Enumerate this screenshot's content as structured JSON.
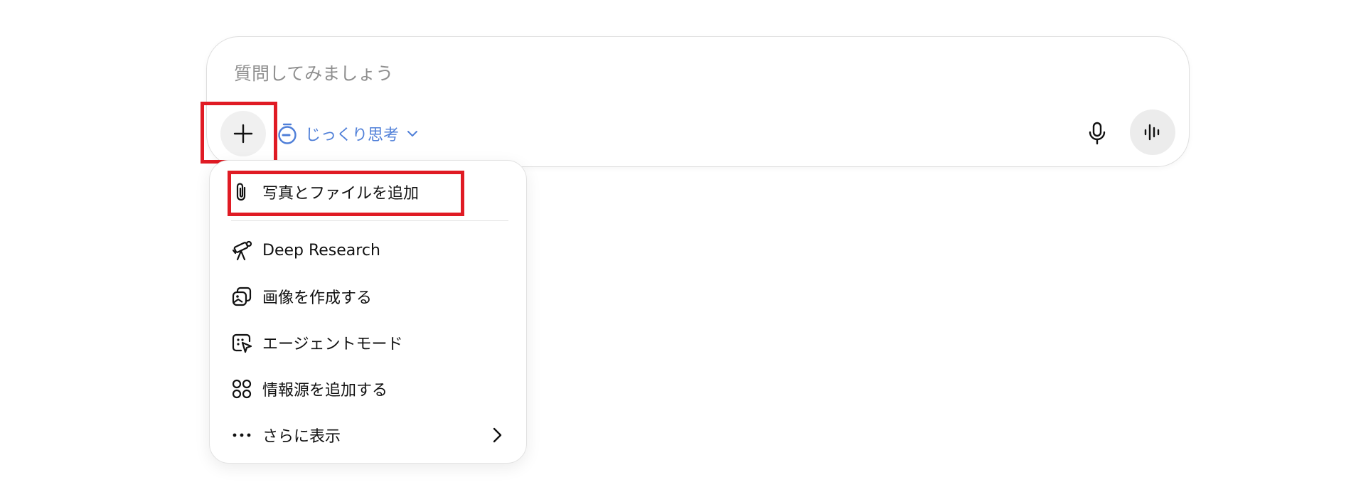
{
  "composer": {
    "placeholder": "質問してみましょう",
    "mode_label": "じっくり思考"
  },
  "menu": {
    "items": [
      {
        "label": "写真とファイルを追加",
        "icon": "paperclip-icon"
      },
      {
        "label": "Deep Research",
        "icon": "telescope-icon"
      },
      {
        "label": "画像を作成する",
        "icon": "image-create-icon"
      },
      {
        "label": "エージェントモード",
        "icon": "agent-cursor-icon"
      },
      {
        "label": "情報源を追加する",
        "icon": "sources-icon"
      },
      {
        "label": "さらに表示",
        "icon": "more-dots-icon"
      }
    ]
  },
  "colors": {
    "accent": "#4f7fd8",
    "highlight": "#e01b24",
    "placeholder": "#8f8f8f"
  }
}
